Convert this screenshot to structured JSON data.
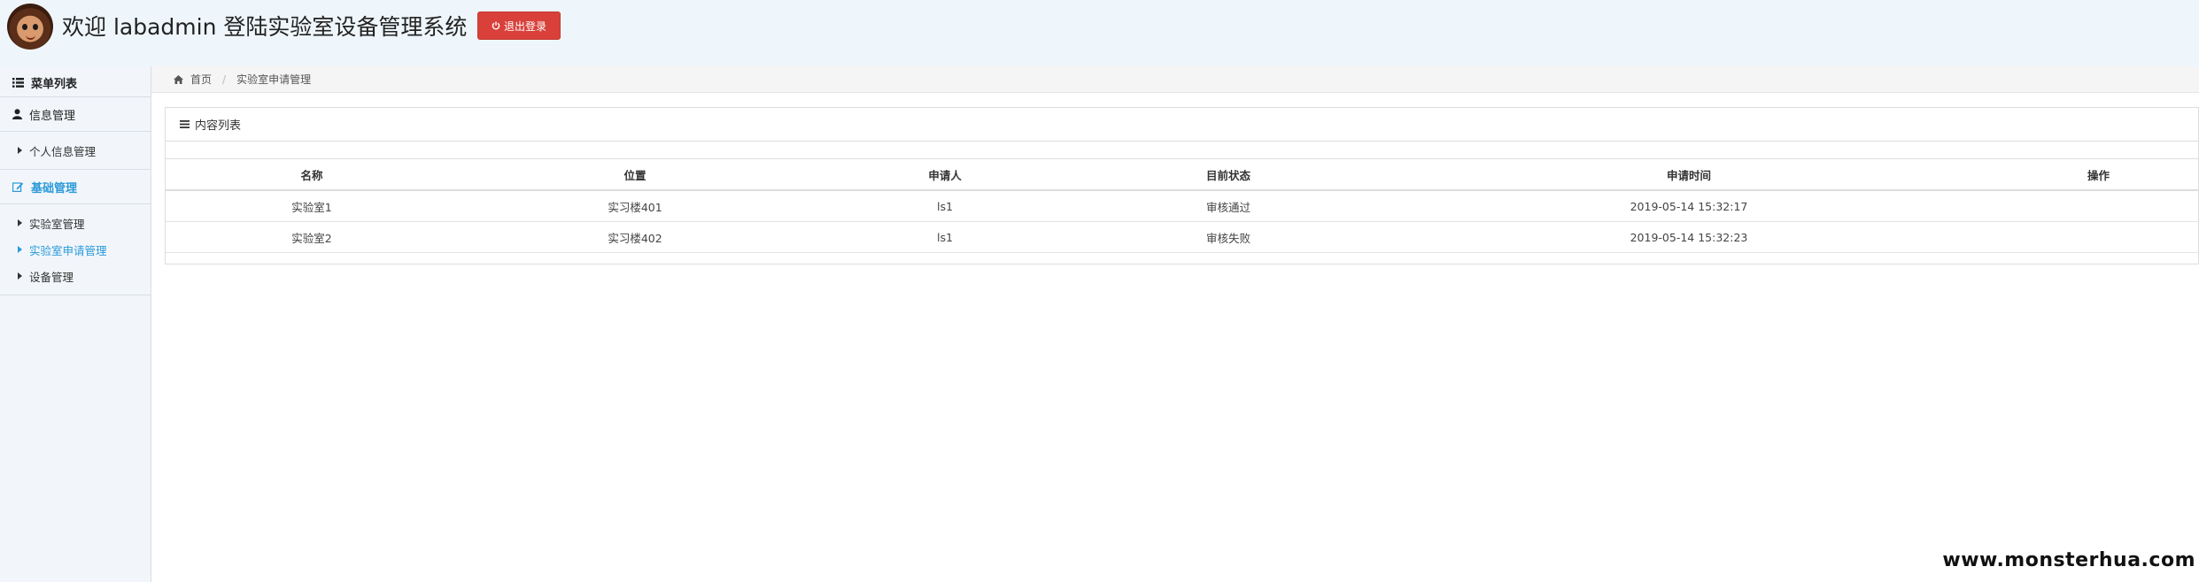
{
  "header": {
    "title": "欢迎 labadmin 登陆实验室设备管理系统",
    "logout_label": "退出登录",
    "logout_color": "#d9403a"
  },
  "sidebar": {
    "heading": "菜单列表",
    "groups": [
      {
        "label": "信息管理",
        "icon": "user-icon",
        "items": [
          "个人信息管理"
        ]
      },
      {
        "label": "基础管理",
        "icon": "edit-icon",
        "items": [
          "实验室管理",
          "实验室申请管理",
          "设备管理"
        ]
      }
    ],
    "active_item": "实验室申请管理",
    "accent_color": "#2b9ad8"
  },
  "breadcrumb": {
    "home": "首页",
    "current": "实验室申请管理"
  },
  "panel": {
    "title": "内容列表",
    "columns": [
      "名称",
      "位置",
      "申请人",
      "目前状态",
      "申请时间",
      "操作"
    ],
    "rows": [
      [
        "实验室1",
        "实习楼401",
        "ls1",
        "审核通过",
        "2019-05-14 15:32:17",
        ""
      ],
      [
        "实验室2",
        "实习楼402",
        "ls1",
        "审核失败",
        "2019-05-14 15:32:23",
        ""
      ]
    ]
  },
  "watermark": "www.monsterhua.com"
}
